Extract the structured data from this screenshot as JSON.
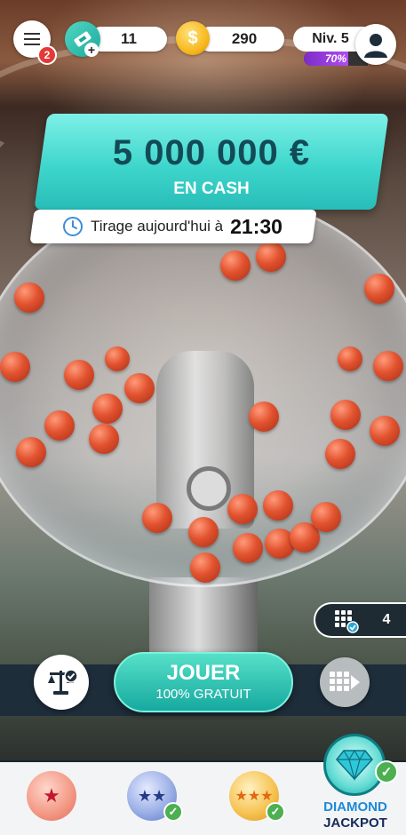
{
  "topbar": {
    "notifications": "2",
    "tickets": "11",
    "coins": "290",
    "coin_symbol": "$",
    "ticket_plus": "+",
    "level": "Niv. 5",
    "level_progress": "70%",
    "level_progress_value": 0.7
  },
  "banner": {
    "amount": "5 000 000 €",
    "subtitle": "EN CASH",
    "draw_label": "Tirage aujourd'hui à",
    "draw_time": "21:30"
  },
  "grids": {
    "count": "4"
  },
  "play": {
    "label": "JOUER",
    "sublabel": "100% GRATUIT"
  },
  "bottom_nav": {
    "items": [
      {
        "icon": "one-star-ball-icon",
        "glyph": "★"
      },
      {
        "icon": "two-star-ball-icon",
        "glyph": "★★"
      },
      {
        "icon": "three-star-ball-icon",
        "glyph": "★★★"
      }
    ],
    "diamond_line1": "DIAMOND",
    "diamond_line2": "JACKPOT"
  },
  "colors": {
    "accent": "#3ed6cc",
    "dark": "#1e2d3a",
    "level": "#8a34d6"
  }
}
